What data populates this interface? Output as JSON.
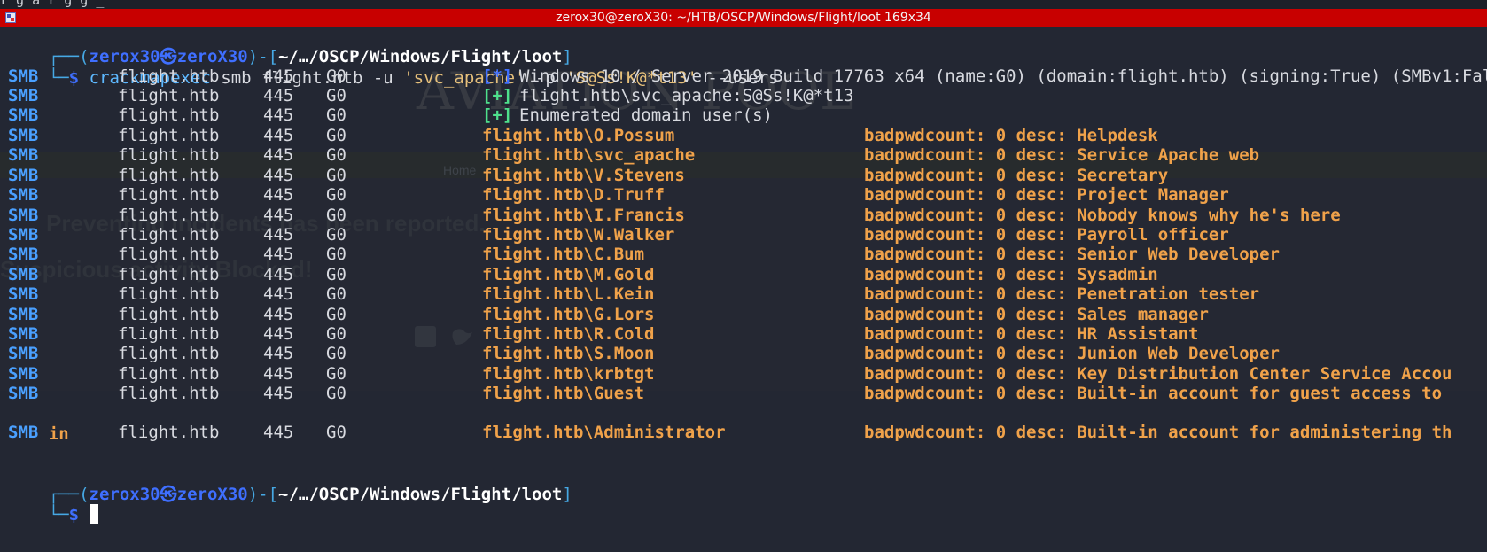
{
  "window": {
    "title": "zerox30@zeroX30: ~/HTB/OSCP/Windows/Flight/loot 169x34",
    "top_snippet": "r g a  r g        g          _"
  },
  "prompt": {
    "open": "┌──(",
    "user": "zerox30",
    "at": "㉿",
    "host": "zeroX30",
    "mid": ")-[",
    "path": "~/…/OSCP/Windows/Flight/loot",
    "close": "]",
    "dollar_prefix": "└─",
    "dollar": "$"
  },
  "command": {
    "bin": "crackmapexec",
    "args1": " smb flight.htb -u ",
    "user_str": "'svc_apache'",
    "args2": " -p ",
    "pass_str": "'S@Ss!K@*t13'",
    "args3": " --users"
  },
  "smb_meta": {
    "proto": "SMB",
    "host": "flight.htb",
    "port": "445",
    "name": "G0"
  },
  "status_lines": [
    {
      "tag": "[*]",
      "text": "Windows 10 / Server 2019 Build 17763 x64 (name:G0) (domain:flight.htb) (signing:True) (SMBv1:Fal"
    },
    {
      "tag": "[+]",
      "text": "flight.htb\\svc_apache:S@Ss!K@*t13"
    },
    {
      "tag": "[+]",
      "text": "Enumerated domain user(s)"
    }
  ],
  "users": [
    {
      "account": "flight.htb\\O.Possum",
      "badpwd": "badpwdcount: 0 desc: Helpdesk"
    },
    {
      "account": "flight.htb\\svc_apache",
      "badpwd": "badpwdcount: 0 desc: Service Apache web"
    },
    {
      "account": "flight.htb\\V.Stevens",
      "badpwd": "badpwdcount: 0 desc: Secretary"
    },
    {
      "account": "flight.htb\\D.Truff",
      "badpwd": "badpwdcount: 0 desc: Project Manager"
    },
    {
      "account": "flight.htb\\I.Francis",
      "badpwd": "badpwdcount: 0 desc: Nobody knows why he's here"
    },
    {
      "account": "flight.htb\\W.Walker",
      "badpwd": "badpwdcount: 0 desc: Payroll officer"
    },
    {
      "account": "flight.htb\\C.Bum",
      "badpwd": "badpwdcount: 0 desc: Senior Web Developer"
    },
    {
      "account": "flight.htb\\M.Gold",
      "badpwd": "badpwdcount: 0 desc: Sysadmin"
    },
    {
      "account": "flight.htb\\L.Kein",
      "badpwd": "badpwdcount: 0 desc: Penetration tester"
    },
    {
      "account": "flight.htb\\G.Lors",
      "badpwd": "badpwdcount: 0 desc: Sales manager"
    },
    {
      "account": "flight.htb\\R.Cold",
      "badpwd": "badpwdcount: 0 desc: HR Assistant"
    },
    {
      "account": "flight.htb\\S.Moon",
      "badpwd": "badpwdcount: 0 desc: Junion Web Developer"
    },
    {
      "account": "flight.htb\\krbtgt",
      "badpwd": "badpwdcount: 0 desc: Key Distribution Center Service Accou"
    },
    {
      "account": "flight.htb\\Guest",
      "badpwd": "badpwdcount: 0 desc: Built-in account for guest access to"
    },
    {
      "account": "flight.htb\\Administrator",
      "badpwd": "badpwdcount: 0 desc: Built-in account for administering th"
    }
  ],
  "wrap_text": "in",
  "watermark": {
    "brand": "AVIATION POOL",
    "line1": "Preventing incidents has been reported.",
    "line2": "Suspicious activity Blocked!",
    "nav": "Home"
  }
}
